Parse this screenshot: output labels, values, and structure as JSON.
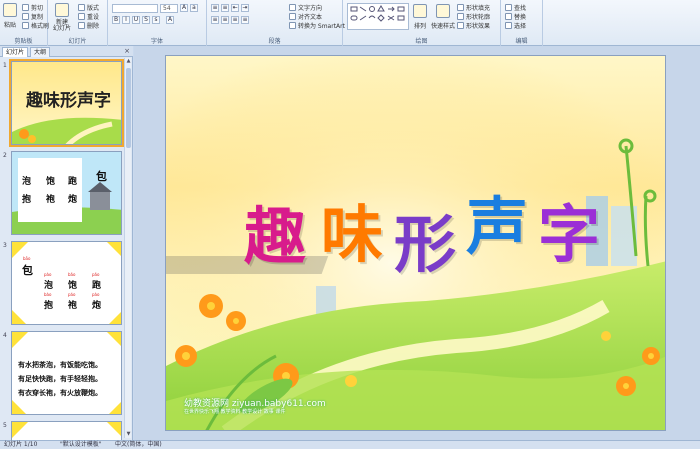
{
  "ribbon": {
    "clipboard": {
      "paste": "粘贴",
      "cut": "剪切",
      "copy": "复制",
      "format_painter": "格式刷",
      "label": "剪贴板"
    },
    "slides": {
      "new_slide": "新建\n幻灯片",
      "layout": "版式",
      "reset": "重设",
      "delete": "删除",
      "label": "幻灯片"
    },
    "font": {
      "font_size": "54",
      "label": "字体"
    },
    "paragraph": {
      "text_direction": "文字方向",
      "align_text": "对齐文本",
      "smartart": "转换为 SmartArt",
      "label": "段落"
    },
    "drawing": {
      "arrange": "排列",
      "quick_styles": "快速样式",
      "shape_fill": "形状填充",
      "shape_outline": "形状轮廓",
      "shape_effects": "形状效果",
      "label": "绘图"
    },
    "editing": {
      "find": "查找",
      "replace": "替换",
      "select": "选择",
      "label": "编辑"
    }
  },
  "pane": {
    "tab_slides": "幻灯片",
    "tab_outline": "大纲",
    "close": "×",
    "thumbs": [
      {
        "num": "1",
        "title": "趣味形声字"
      },
      {
        "num": "2",
        "chars": [
          "泡",
          "饱",
          "跑",
          "抱",
          "袍",
          "炮"
        ],
        "single": "包"
      },
      {
        "num": "3",
        "single": "包",
        "single_pinyin": "bāo",
        "chars": [
          "泡",
          "饱",
          "跑",
          "抱",
          "袍",
          "炮"
        ],
        "pinyin": [
          "pào",
          "bǎo",
          "pǎo",
          "bào",
          "páo",
          "pào"
        ]
      },
      {
        "num": "4",
        "lines": [
          "有水把茶泡，有饭能吃饱。",
          "有足快快跑，有手轻轻抱。",
          "有衣穿长袍，有火放鞭炮。"
        ]
      },
      {
        "num": "5"
      }
    ]
  },
  "slide": {
    "title_chars": [
      {
        "char": "趣",
        "color": "#d81b8c"
      },
      {
        "char": "味",
        "color": "#ff7a00"
      },
      {
        "char": "形",
        "color": "#7a3cc8"
      },
      {
        "char": "声",
        "color": "#1a7ee0"
      },
      {
        "char": "字",
        "color": "#9b2fd6"
      }
    ],
    "watermark": "幼教资源网 ziyuan.baby611.com",
    "watermark_sub": "在世界快乐飞翔  教学资料  教学设计  故事  课件"
  },
  "status": {
    "slide_info": "幻灯片 1/10",
    "theme": "\"默认设计模板\"",
    "language": "中文(简体，中国)"
  },
  "colors": {
    "ribbon_bg": "#dfe9f5",
    "selected_thumb": "#f0a830",
    "workspace_bg": "#c7d6ea"
  }
}
